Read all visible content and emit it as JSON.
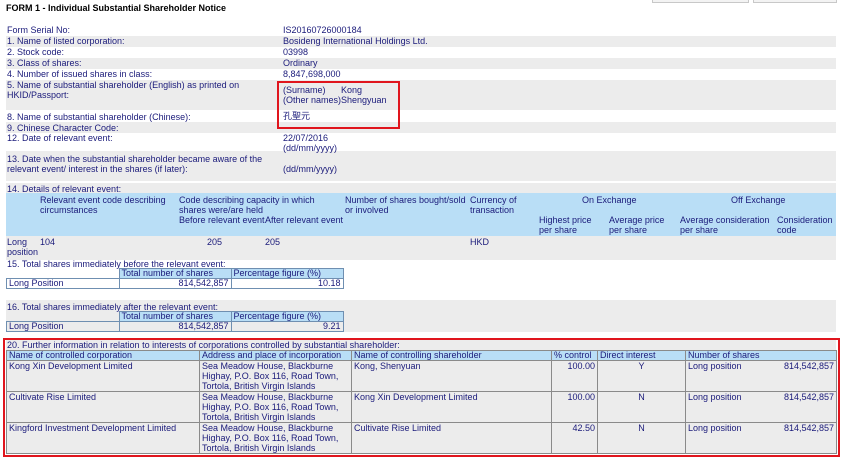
{
  "title": "FORM 1 - Individual Substantial Shareholder Notice",
  "fields": [
    {
      "label": "Form Serial No:",
      "value": "IS20160726000184"
    },
    {
      "label": "1. Name of listed corporation:",
      "value": "Bosideng International Holdings Ltd."
    },
    {
      "label": "2. Stock code:",
      "value": "03998"
    },
    {
      "label": "3. Class of shares:",
      "value": "Ordinary"
    },
    {
      "label": "4. Number of issued shares in class:",
      "value": "8,847,698,000"
    }
  ],
  "q5": {
    "label_line1": "5. Name of substantial shareholder (English) as printed on",
    "label_line2": "HKID/Passport:",
    "surname_label": "(Surname)",
    "surname": "Kong",
    "other_label": "(Other names)",
    "other": "Shengyuan"
  },
  "q8": {
    "label": "8. Name of substantial shareholder (Chinese):",
    "value": "孔聖元"
  },
  "q9": {
    "label": "9. Chinese Character Code:"
  },
  "q12": {
    "label": "12. Date of relevant event:",
    "value": "22/07/2016",
    "format": "(dd/mm/yyyy)"
  },
  "q13": {
    "label_line1": "13. Date when the substantial shareholder became aware of the",
    "label_line2": "relevant event/ interest in the shares (if later):",
    "format": "(dd/mm/yyyy)"
  },
  "q14": {
    "label": "14. Details of relevant event:",
    "headers": {
      "code_event": "Relevant event code describing circumstances",
      "code_capacity": "Code describing capacity in which shares were/are held",
      "before": "Before relevant event",
      "after": "After relevant event",
      "num_shares": "Number of shares bought/sold or involved",
      "currency": "Currency of transaction",
      "on_exchange": "On Exchange",
      "off_exchange": "Off Exchange",
      "highest": "Highest price per share",
      "avg_price": "Average price per share",
      "avg_consideration": "Average consideration per share",
      "consideration_code": "Consideration code"
    },
    "row": {
      "position": "Long position",
      "event_code": "104",
      "before": "205",
      "after": "205",
      "currency": "HKD"
    }
  },
  "q15": {
    "label": "15. Total shares immediately before the relevant event:",
    "col_total": "Total number of shares",
    "col_pct": "Percentage figure (%)",
    "row_label": "Long Position",
    "total": "814,542,857",
    "pct": "10.18"
  },
  "q16": {
    "label": "16. Total shares immediately after the relevant event:",
    "col_total": "Total number of shares",
    "col_pct": "Percentage figure (%)",
    "row_label": "Long Position",
    "total": "814,542,857",
    "pct": "9.21"
  },
  "q20": {
    "label": "20. Further information in relation to interests of corporations controlled by substantial shareholder:",
    "headers": {
      "corp": "Name of controlled corporation",
      "address": "Address and place of incorporation",
      "controller": "Name of controlling shareholder",
      "pct": "% control",
      "direct": "Direct interest",
      "shares": "Number of shares"
    },
    "rows": [
      {
        "corp": "Kong Xin Development Limited",
        "address": "Sea Meadow House, Blackburne Highay, P.O. Box 116, Road Town, Tortola, British Virgin Islands",
        "controller": "Kong, Shenyuan",
        "pct": "100.00",
        "direct": "Y",
        "position": "Long position",
        "shares": "814,542,857"
      },
      {
        "corp": "Cultivate Rise Limited",
        "address": "Sea Meadow House, Blackburne Highay, P.O. Box 116, Road Town, Tortola, British Virgin Islands",
        "controller": "Kong Xin Development Limited",
        "pct": "100.00",
        "direct": "N",
        "position": "Long position",
        "shares": "814,542,857"
      },
      {
        "corp": "Kingford Investment Development Limited",
        "address": "Sea Meadow House, Blackburne Highay, P.O. Box 116, Road Town, Tortola, British Virgin Islands",
        "controller": "Cultivate Rise Limited",
        "pct": "42.50",
        "direct": "N",
        "position": "Long position",
        "shares": "814,542,857"
      }
    ]
  },
  "colors": {
    "header_blue": "#b9def6",
    "band_gray": "#ececec",
    "highlight_red": "#e0151d",
    "text_navy": "#1a1a7a"
  }
}
